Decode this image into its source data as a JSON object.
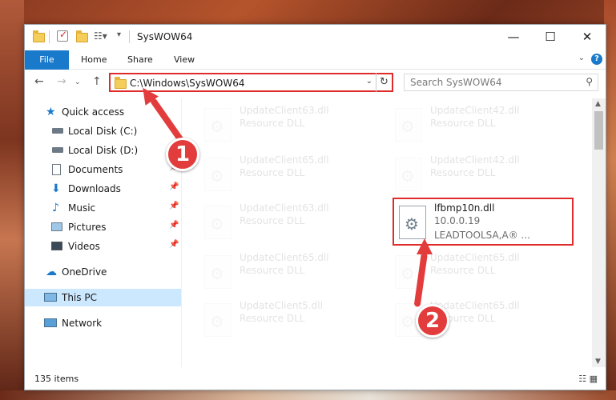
{
  "window": {
    "title": "SysWOW64",
    "minimize": "—",
    "maximize": "☐",
    "close": "✕"
  },
  "ribbon": {
    "tabs": [
      "File",
      "Home",
      "Share",
      "View"
    ],
    "help": "?"
  },
  "address": {
    "path": "C:\\Windows\\SysWOW64",
    "search_placeholder": "Search SysWOW64"
  },
  "sidebar": {
    "items": [
      {
        "label": "Quick access",
        "icon": "star-icon"
      },
      {
        "label": "Local Disk (C:)",
        "icon": "drive-icon"
      },
      {
        "label": "Local Disk (D:)",
        "icon": "drive-icon"
      },
      {
        "label": "Documents",
        "icon": "documents-icon",
        "pinned": true
      },
      {
        "label": "Downloads",
        "icon": "downloads-icon",
        "pinned": true
      },
      {
        "label": "Music",
        "icon": "music-icon",
        "pinned": true
      },
      {
        "label": "Pictures",
        "icon": "pictures-icon",
        "pinned": true
      },
      {
        "label": "Videos",
        "icon": "videos-icon",
        "pinned": true
      },
      {
        "label": "OneDrive",
        "icon": "cloud-icon"
      },
      {
        "label": "This PC",
        "icon": "computer-icon",
        "selected": true
      },
      {
        "label": "Network",
        "icon": "network-icon"
      }
    ]
  },
  "files": [
    {
      "name": "UpdateClient63.dll",
      "desc": "Resource DLL"
    },
    {
      "name": "UpdateClient42.dll",
      "desc": "Resource DLL"
    },
    {
      "name": "UpdateClient65.dll",
      "desc": "Resource DLL"
    },
    {
      "name": "UpdateClient42.dll",
      "desc": "Resource DLL"
    },
    {
      "name": "UpdateClient63.dll",
      "desc": "Resource DLL"
    },
    {
      "name": "lfbmp10n.dll",
      "desc": "10.0.0.19",
      "extra": "LEADTOOLSA,A® ...",
      "highlighted": true
    },
    {
      "name": "UpdateClient65.dll",
      "desc": "Resource DLL"
    },
    {
      "name": "UpdateClient65.dll",
      "desc": "Resource DLL"
    },
    {
      "name": "UpdateClient5.dll",
      "desc": "Resource DLL"
    },
    {
      "name": "UpdateClient65.dll",
      "desc": "Resource DLL"
    }
  ],
  "status": {
    "item_count": "135 items"
  },
  "annotations": {
    "step1": "1",
    "step2": "2"
  },
  "colors": {
    "accent": "#1979ca",
    "highlight": "#e02b2b",
    "selection": "#cce8ff"
  }
}
